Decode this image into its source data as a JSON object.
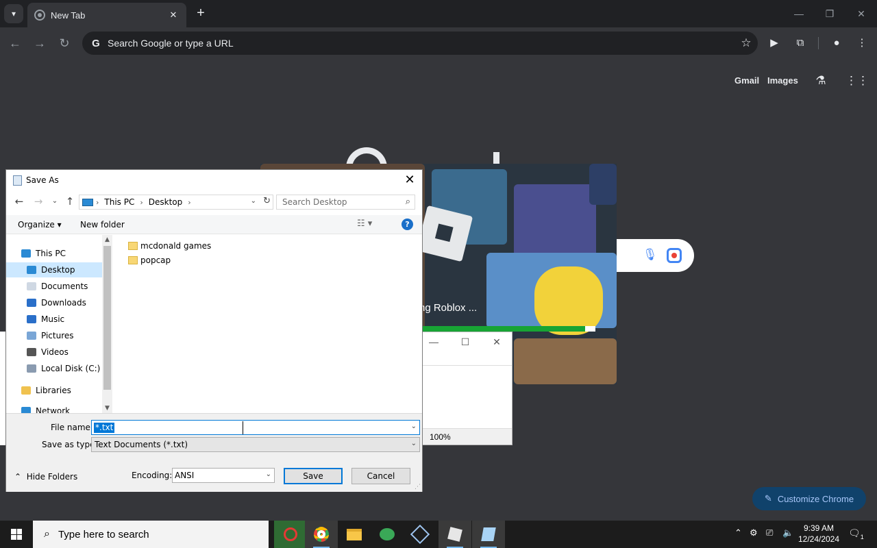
{
  "browser": {
    "tab_title": "New Tab",
    "omnibox_placeholder": "Search Google or type a URL",
    "ntp_links": {
      "gmail": "Gmail",
      "images": "Images"
    },
    "customize_label": "Customize Chrome"
  },
  "roblox": {
    "loading_text": "ng Roblox ...",
    "progress": 0.94,
    "progress_color": "#17a434"
  },
  "notepad": {
    "zoom": "100%"
  },
  "dialog": {
    "title": "Save As",
    "breadcrumb": [
      "This PC",
      "Desktop"
    ],
    "search_placeholder": "Search Desktop",
    "organize_label": "Organize",
    "new_folder_label": "New folder",
    "nav_items": [
      {
        "label": "This PC",
        "icon": "pc-icon",
        "selected": false
      },
      {
        "label": "Desktop",
        "icon": "desktop-icon",
        "selected": true
      },
      {
        "label": "Documents",
        "icon": "documents-icon",
        "selected": false
      },
      {
        "label": "Downloads",
        "icon": "downloads-icon",
        "selected": false
      },
      {
        "label": "Music",
        "icon": "music-icon",
        "selected": false
      },
      {
        "label": "Pictures",
        "icon": "pictures-icon",
        "selected": false
      },
      {
        "label": "Videos",
        "icon": "videos-icon",
        "selected": false
      },
      {
        "label": "Local Disk (C:)",
        "icon": "disk-icon",
        "selected": false
      },
      {
        "label": "Libraries",
        "icon": "libraries-icon",
        "selected": false
      },
      {
        "label": "Network",
        "icon": "network-icon",
        "selected": false
      }
    ],
    "files": [
      {
        "name": "mcdonald games",
        "type": "folder"
      },
      {
        "name": "popcap",
        "type": "folder"
      }
    ],
    "file_name_label": "File name:",
    "file_name_value": "*.txt",
    "save_type_label": "Save as type:",
    "save_type_value": "Text Documents (*.txt)",
    "hide_folders_label": "Hide Folders",
    "encoding_label": "Encoding:",
    "encoding_value": "ANSI",
    "save_label": "Save",
    "cancel_label": "Cancel"
  },
  "taskbar": {
    "search_placeholder": "Type here to search",
    "time": "9:39 AM",
    "date": "12/24/2024",
    "notification_count": "1"
  }
}
